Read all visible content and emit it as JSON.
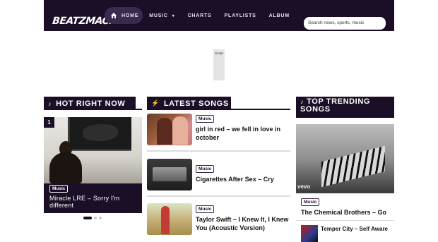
{
  "header": {
    "logo_text": "BEATZMACK",
    "nav": [
      {
        "label": "HOME",
        "icon": "home-icon"
      },
      {
        "label": "MUSIC",
        "icon": "caret-down-icon"
      },
      {
        "label": "CHARTS"
      },
      {
        "label": "PLAYLISTS"
      },
      {
        "label": "ALBUM"
      }
    ],
    "search_placeholder": "Search news, sports, music"
  },
  "ad": {
    "label": "RTISE"
  },
  "hot": {
    "title": "HOT RIGHT NOW",
    "icon": "music-note-icon",
    "card": {
      "rank": "1",
      "tag": "Music",
      "title": "Miracle LRE – Sorry I'm different"
    }
  },
  "latest": {
    "title": "LATEST SONGS",
    "icon": "bolt-icon",
    "songs": [
      {
        "tag": "Music",
        "title": "girl in red – we fell in love in october"
      },
      {
        "tag": "Music",
        "title": "Cigarettes After Sex – Cry"
      },
      {
        "tag": "Music",
        "title": "Taylor Swift – I Knew It, I Knew You (Acoustic Version)"
      }
    ]
  },
  "trending": {
    "title": "TOP TRENDING SONGS",
    "icon": "music-note-icon",
    "featured": {
      "tag": "Music",
      "title": "The Chemical Brothers – Go",
      "watermark": "vevo"
    },
    "items": [
      {
        "title": "Temper City – Self Aware"
      }
    ]
  },
  "colors": {
    "brand_dark": "#1a0f26",
    "accent": "#3a2a4d"
  }
}
